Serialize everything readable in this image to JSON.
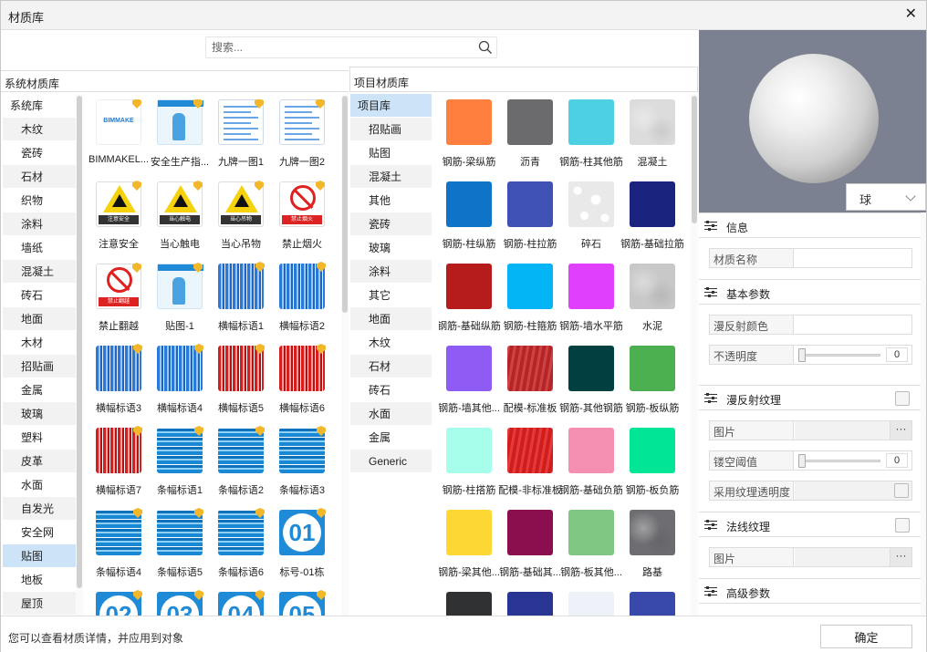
{
  "window": {
    "title": "材质库",
    "close": "✕"
  },
  "search": {
    "placeholder": "搜索..."
  },
  "system": {
    "header": "系统材质库",
    "categories": [
      "系统库",
      "木纹",
      "瓷砖",
      "石材",
      "织物",
      "涂料",
      "墙纸",
      "混凝土",
      "砖石",
      "地面",
      "木材",
      "招贴画",
      "金属",
      "玻璃",
      "塑料",
      "皮革",
      "水面",
      "自发光",
      "安全网",
      "贴图",
      "地板",
      "屋顶"
    ],
    "selected": 19,
    "items": [
      {
        "label": "BIMMAKEL...",
        "kind": "logo",
        "logo": "BIMMAKE"
      },
      {
        "label": "安全生产指...",
        "kind": "poster"
      },
      {
        "label": "九牌一图1",
        "kind": "doc"
      },
      {
        "label": "九牌一图2",
        "kind": "doc"
      },
      {
        "label": "注意安全",
        "kind": "warn",
        "tag": "注意安全"
      },
      {
        "label": "当心触电",
        "kind": "warn",
        "tag": "当心触电"
      },
      {
        "label": "当心吊物",
        "kind": "warn",
        "tag": "当心吊物"
      },
      {
        "label": "禁止烟火",
        "kind": "ban-sign",
        "tag": "禁止烟火"
      },
      {
        "label": "禁止翻越",
        "kind": "ban-sign",
        "tag": "禁止翻越"
      },
      {
        "label": "贴图-1",
        "kind": "poster"
      },
      {
        "label": "横幅标语1",
        "kind": "banner"
      },
      {
        "label": "横幅标语2",
        "kind": "banner"
      },
      {
        "label": "横幅标语3",
        "kind": "banner"
      },
      {
        "label": "横幅标语4",
        "kind": "banner"
      },
      {
        "label": "横幅标语5",
        "kind": "banner-red"
      },
      {
        "label": "横幅标语6",
        "kind": "banner-red"
      },
      {
        "label": "横幅标语7",
        "kind": "banner-red"
      },
      {
        "label": "条幅标语1",
        "kind": "stripe"
      },
      {
        "label": "条幅标语2",
        "kind": "stripe"
      },
      {
        "label": "条幅标语3",
        "kind": "stripe"
      },
      {
        "label": "条幅标语4",
        "kind": "stripe"
      },
      {
        "label": "条幅标语5",
        "kind": "stripe"
      },
      {
        "label": "条幅标语6",
        "kind": "stripe"
      },
      {
        "label": "标号-01栋",
        "kind": "num",
        "num": "01"
      },
      {
        "kind": "num",
        "num": "02"
      },
      {
        "kind": "num",
        "num": "03"
      },
      {
        "kind": "num",
        "num": "04"
      },
      {
        "kind": "num",
        "num": "05"
      }
    ]
  },
  "project": {
    "header": "项目材质库",
    "categories": [
      "项目库",
      "招贴画",
      "贴图",
      "混凝土",
      "其他",
      "瓷砖",
      "玻璃",
      "涂料",
      "其它",
      "地面",
      "木纹",
      "石材",
      "砖石",
      "水面",
      "金属",
      "Generic"
    ],
    "selected": 0,
    "items": [
      {
        "label": "钢筋-梁纵筋",
        "color": "#ff7f3f"
      },
      {
        "label": "沥青",
        "color": "#6b6b6e"
      },
      {
        "label": "钢筋-柱其他筋",
        "color": "#4dd0e1"
      },
      {
        "label": "混凝土",
        "color": "#dcdcdc",
        "tex": "concrete"
      },
      {
        "label": "钢筋-柱纵筋",
        "color": "#0f73c8"
      },
      {
        "label": "钢筋-柱拉筋",
        "color": "#3f51b5"
      },
      {
        "label": "碎石",
        "color": "#e9e9e9",
        "tex": "gravel"
      },
      {
        "label": "钢筋-基础拉筋",
        "color": "#1a237e"
      },
      {
        "label": "钢筋-基础纵筋",
        "color": "#b71c1c"
      },
      {
        "label": "钢筋-柱箍筋",
        "color": "#03b5f5"
      },
      {
        "label": "钢筋-墙水平筋",
        "color": "#e040fb"
      },
      {
        "label": "水泥",
        "color": "#c8c8c8",
        "tex": "concrete"
      },
      {
        "label": "钢筋-墙其他...",
        "color": "#8e5cf5"
      },
      {
        "label": "配模-标准板",
        "color": "#c62828",
        "tex": "wood"
      },
      {
        "label": "钢筋-其他钢筋",
        "color": "#004040"
      },
      {
        "label": "钢筋-板纵筋",
        "color": "#4caf50"
      },
      {
        "label": "钢筋-柱搭筋",
        "color": "#a7ffeb"
      },
      {
        "label": "配模-非标准板",
        "color": "#e11f1f",
        "tex": "wood"
      },
      {
        "label": "钢筋-基础负筋",
        "color": "#f48fb1"
      },
      {
        "label": "钢筋-板负筋",
        "color": "#00e696"
      },
      {
        "label": "钢筋-梁其他...",
        "color": "#fdd835"
      },
      {
        "label": "钢筋-基础其...",
        "color": "#8b0f4f"
      },
      {
        "label": "钢筋-板其他...",
        "color": "#81c784"
      },
      {
        "label": "路基",
        "color": "#6e6e72",
        "tex": "concrete"
      },
      {
        "color": "#2f3133"
      },
      {
        "color": "#283593"
      },
      {
        "color": "#eef2f8"
      },
      {
        "color": "#3949ab"
      }
    ]
  },
  "preview": {
    "shape": "球"
  },
  "props": {
    "info": {
      "title": "信息",
      "name_label": "材质名称",
      "name_value": ""
    },
    "basic": {
      "title": "基本参数",
      "diffuse_label": "漫反射颜色",
      "opacity_label": "不透明度",
      "opacity_value": "0",
      "opacity": 0
    },
    "diffuse_tex": {
      "title": "漫反射纹理",
      "image_label": "图片",
      "cutoff_label": "镂空阈值",
      "cutoff_value": "0",
      "cutoff": 0,
      "use_alpha_label": "采用纹理透明度"
    },
    "normal_tex": {
      "title": "法线纹理",
      "image_label": "图片"
    },
    "advanced": {
      "title": "高级参数"
    },
    "dots": "···"
  },
  "footer": {
    "message": "您可以查看材质详情，并应用到对象",
    "ok": "确定"
  },
  "icons": {
    "search": "search-icon",
    "close": "close-icon",
    "section": "sliders-icon",
    "badge": "shield-badge-icon"
  }
}
